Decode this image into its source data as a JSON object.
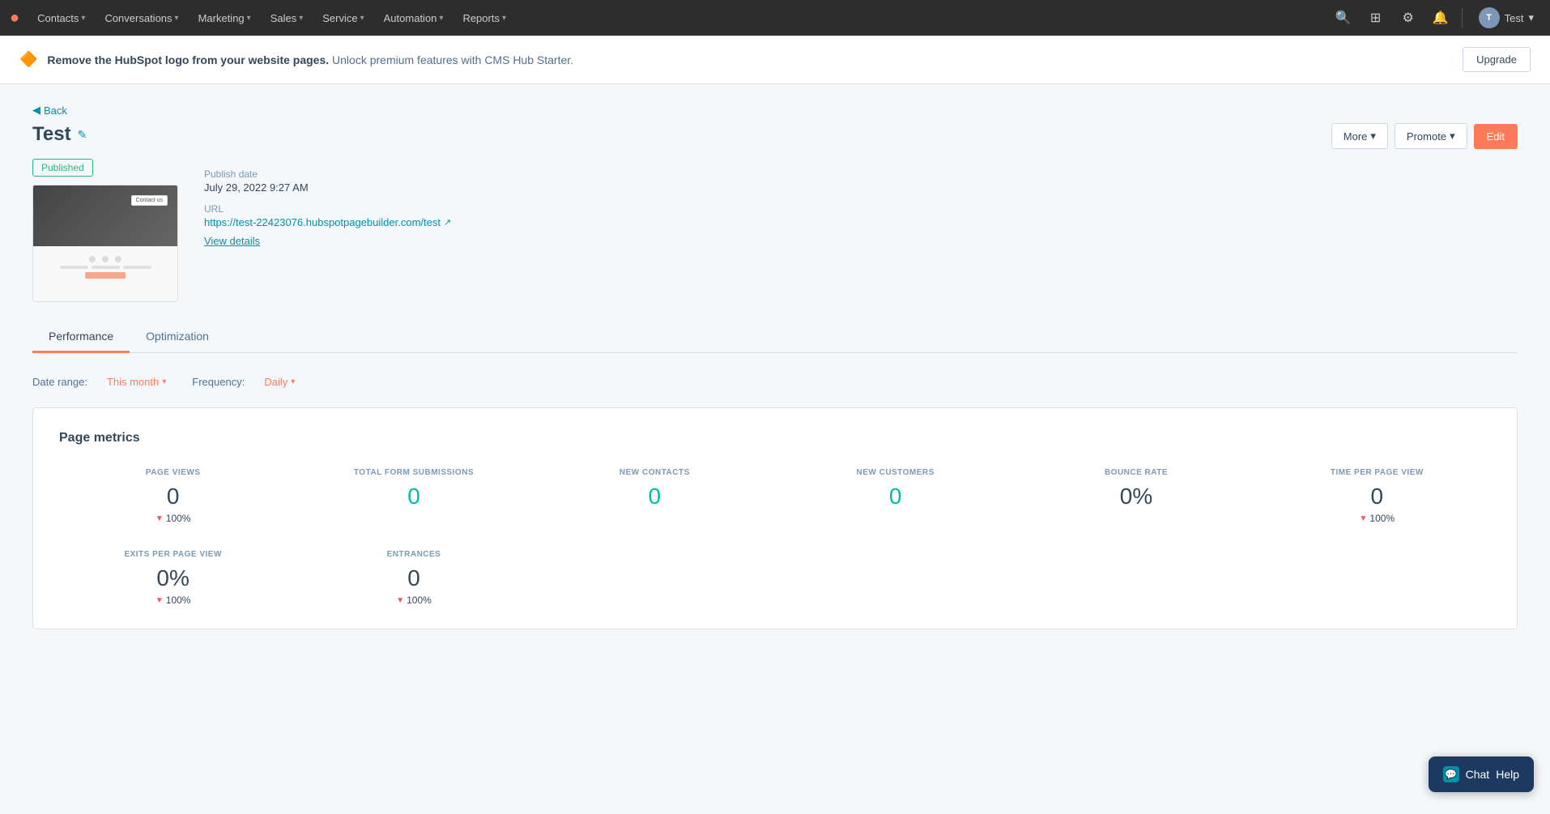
{
  "nav": {
    "logo": "●",
    "items": [
      {
        "label": "Contacts",
        "id": "contacts"
      },
      {
        "label": "Conversations",
        "id": "conversations"
      },
      {
        "label": "Marketing",
        "id": "marketing"
      },
      {
        "label": "Sales",
        "id": "sales"
      },
      {
        "label": "Service",
        "id": "service"
      },
      {
        "label": "Automation",
        "id": "automation"
      },
      {
        "label": "Reports",
        "id": "reports"
      }
    ],
    "user_label": "Test"
  },
  "banner": {
    "icon": "🔶",
    "bold_text": "Remove the HubSpot logo from your website pages.",
    "text": " Unlock premium features with CMS Hub Starter.",
    "upgrade_label": "Upgrade"
  },
  "back_label": "Back",
  "page": {
    "title": "Test",
    "status": "Published",
    "publish_date_label": "Publish date",
    "publish_date": "July 29, 2022 9:27 AM",
    "url_label": "URL",
    "url_text": "https://test-22423076.hubspotpagebuilder.com/test",
    "view_details_label": "View details"
  },
  "buttons": {
    "more": "More",
    "promote": "Promote",
    "edit": "Edit"
  },
  "tabs": [
    {
      "label": "Performance",
      "id": "performance",
      "active": true
    },
    {
      "label": "Optimization",
      "id": "optimization",
      "active": false
    }
  ],
  "filters": {
    "date_range_label": "Date range:",
    "date_range_value": "This month",
    "frequency_label": "Frequency:",
    "frequency_value": "Daily"
  },
  "metrics": {
    "section_title": "Page metrics",
    "items": [
      {
        "label": "PAGE VIEWS",
        "value": "0",
        "teal": false,
        "change": "100%",
        "show_change": true
      },
      {
        "label": "TOTAL FORM SUBMISSIONS",
        "value": "0",
        "teal": true,
        "change": "",
        "show_change": false
      },
      {
        "label": "NEW CONTACTS",
        "value": "0",
        "teal": true,
        "change": "",
        "show_change": false
      },
      {
        "label": "NEW CUSTOMERS",
        "value": "0",
        "teal": true,
        "change": "",
        "show_change": false
      },
      {
        "label": "BOUNCE RATE",
        "value": "0%",
        "teal": false,
        "change": "",
        "show_change": false
      },
      {
        "label": "TIME PER PAGE VIEW",
        "value": "0",
        "teal": false,
        "change": "100%",
        "show_change": true
      }
    ],
    "items_bottom": [
      {
        "label": "EXITS PER PAGE VIEW",
        "value": "0%",
        "teal": false,
        "change": "100%",
        "show_change": true
      },
      {
        "label": "ENTRANCES",
        "value": "0",
        "teal": false,
        "change": "100%",
        "show_change": true
      }
    ]
  },
  "chat": {
    "label": "Chat",
    "help_label": "Help"
  }
}
